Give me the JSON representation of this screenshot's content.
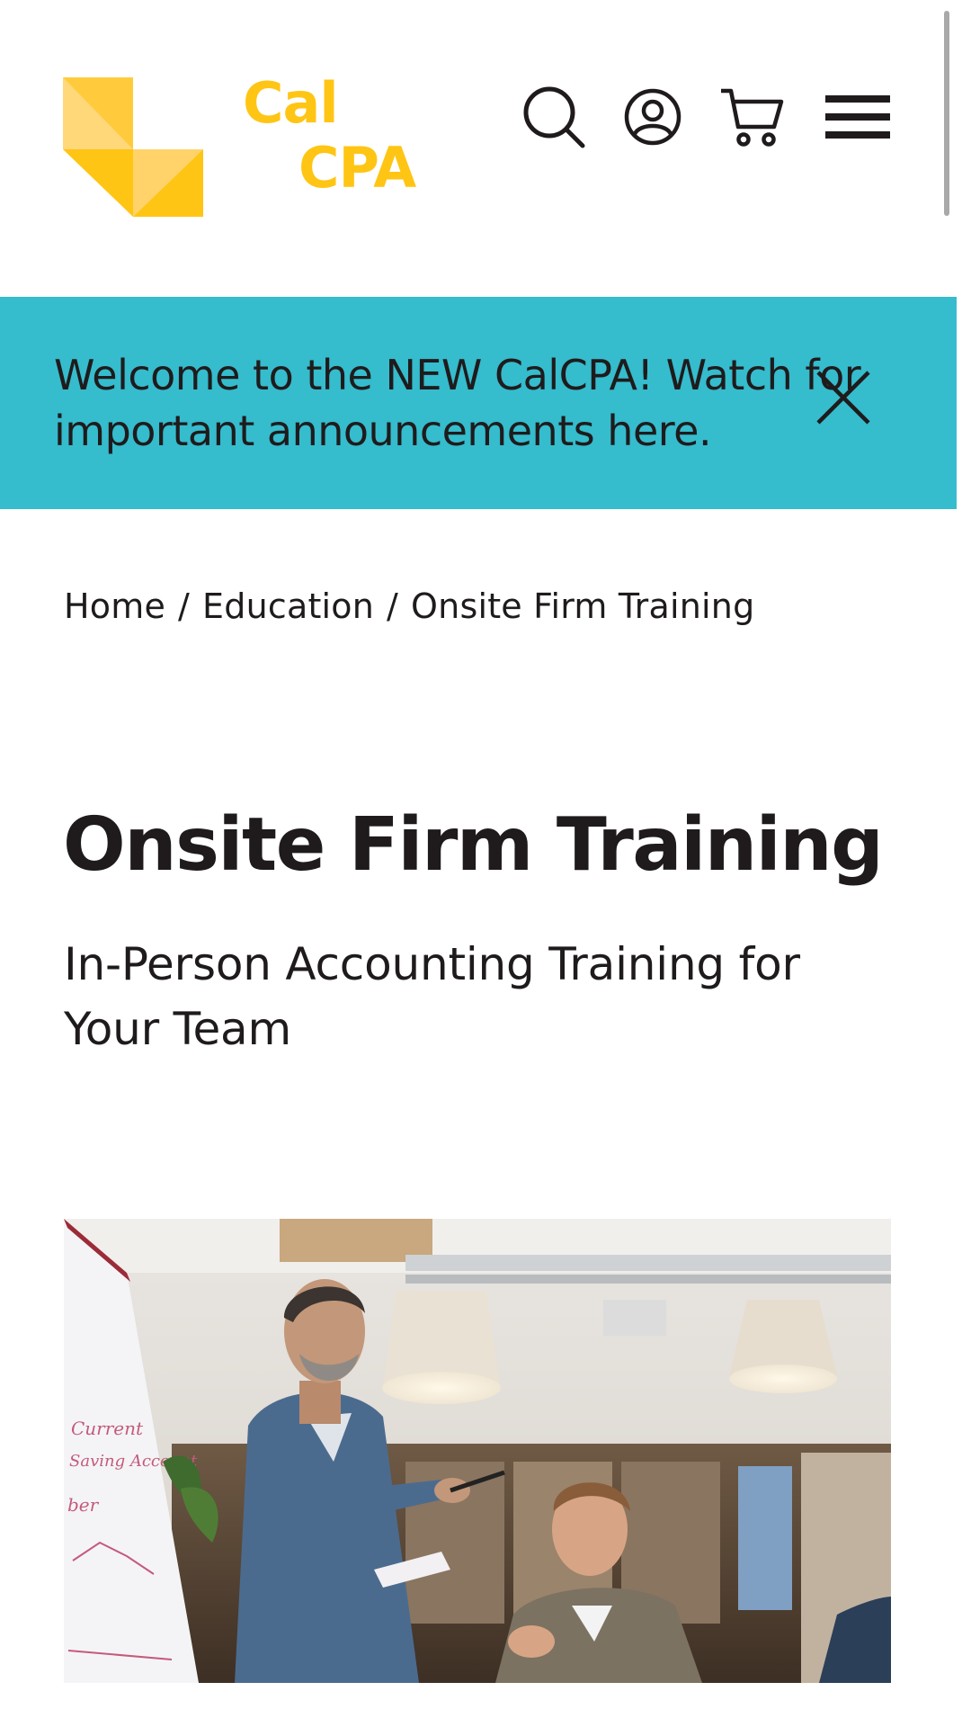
{
  "brand": {
    "logo_line1": "Cal",
    "logo_line2": "CPA",
    "color": "#ffc514",
    "color_light": "#ffd87a"
  },
  "header": {
    "icons": [
      "search-icon",
      "account-icon",
      "cart-icon",
      "hamburger-menu-icon"
    ]
  },
  "announcement": {
    "text": "Welcome to the NEW CalCPA! Watch for important announcements here.",
    "background": "#35bccd",
    "close_icon": "close-icon"
  },
  "breadcrumb": {
    "items": [
      "Home",
      "Education",
      "Onsite Firm Training"
    ],
    "separator": "/"
  },
  "page": {
    "title": "Onsite Firm Training",
    "subtitle": "In-Person Accounting Training for Your Team"
  },
  "hero_image": {
    "whiteboard_text": [
      "Current",
      "Saving Account",
      "ber"
    ]
  }
}
